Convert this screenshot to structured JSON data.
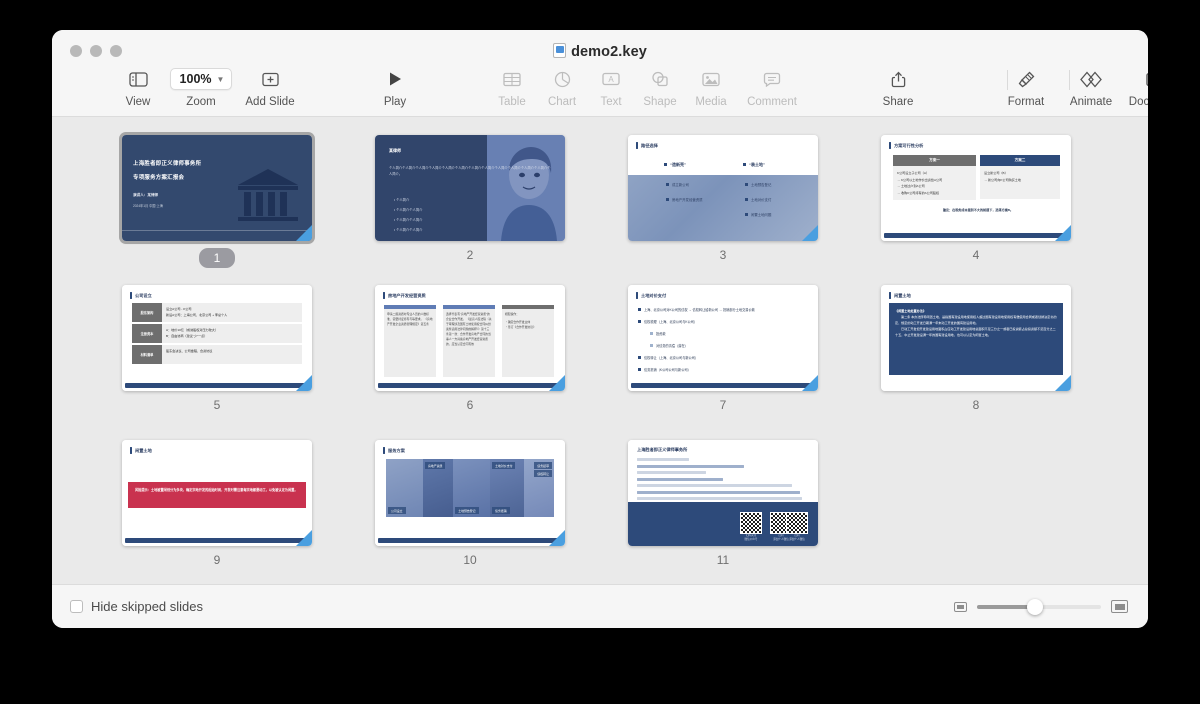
{
  "window": {
    "title": "demo2.key",
    "file_icon": "keynote-file-icon"
  },
  "toolbar": {
    "items": [
      {
        "label": "View",
        "icon": "sidebar-icon",
        "enabled": true
      },
      {
        "label": "Zoom",
        "icon": "zoom-value",
        "value": "100%",
        "enabled": true
      },
      {
        "label": "Add Slide",
        "icon": "plus-square-icon",
        "enabled": true
      },
      {
        "label": "Play",
        "icon": "play-triangle-icon",
        "enabled": true
      },
      {
        "label": "Table",
        "icon": "table-icon",
        "enabled": false
      },
      {
        "label": "Chart",
        "icon": "pie-chart-icon",
        "enabled": false
      },
      {
        "label": "Text",
        "icon": "text-box-icon",
        "enabled": false
      },
      {
        "label": "Shape",
        "icon": "shapes-icon",
        "enabled": false
      },
      {
        "label": "Media",
        "icon": "image-icon",
        "enabled": false
      },
      {
        "label": "Comment",
        "icon": "comment-bubble-icon",
        "enabled": false
      },
      {
        "label": "Share",
        "icon": "share-upload-icon",
        "enabled": true
      },
      {
        "label": "Format",
        "icon": "paintbrush-icon",
        "enabled": true
      },
      {
        "label": "Animate",
        "icon": "animate-diamond-icon",
        "enabled": true
      },
      {
        "label": "Document",
        "icon": "document-icon",
        "enabled": true
      }
    ]
  },
  "navigator": {
    "selected_slide": 1,
    "slides": [
      {
        "number": "1",
        "type": "title",
        "title_line1": "上海胜者即正义律师事务所",
        "title_line2": "专项服务方案汇报会",
        "presenter": "演讲人：某律师",
        "date": "2024年1月 中国·上海"
      },
      {
        "number": "2",
        "type": "profile",
        "title": "某律师",
        "paragraph": "个人简介个人简介个人简介个人简介个人简介个人简介个人简介个人简介个人简介个人简介个人简介个人简介个人简介。",
        "bullets": [
          "个人简介",
          "个人简介个人简介",
          "个人简介个人简介",
          "个人简介个人简介"
        ]
      },
      {
        "number": "3",
        "type": "two-column",
        "title": "路径选择",
        "left_header": "“造新壳”",
        "left_items": [
          "成立新公司",
          "房地产开发经营资质"
        ],
        "right_header": "“装土地”",
        "right_items": [
          "土地预告登记",
          "土地对价支付",
          "闲置土地问题"
        ]
      },
      {
        "number": "4",
        "type": "comparison",
        "title": "方案可行性分析",
        "plan_a_header": "方案一",
        "plan_a_lead": "K公司设立子公司（A）",
        "plan_a_items": [
          "→ K公司以土地作价出资给A公司",
          "→ 土地过户到A公司",
          "→ 收购K公司持有的A公司股权"
        ],
        "plan_b_header": "方案二",
        "plan_b_lead": "设立新公司（B）",
        "plan_b_items": [
          "→ 新公司向K公司购买土地"
        ],
        "footer": "建议：在税务成本差别不大的前提下，选择方案B。"
      },
      {
        "number": "5",
        "type": "table",
        "title": "公司设立",
        "rows": [
          {
            "key": "股东架构",
            "lines": [
              "设立A公司 - K公司",
              "新设A公司：上海公司、北京公司 + 李总个人"
            ]
          },
          {
            "key": "注册资本",
            "lines": [
              "A：地价10亿（成熟股权对压力较大）",
              "B：自由协商（建议“少”一点）"
            ]
          },
          {
            "key": "材料清单",
            "lines": [
              "股东会决议、公司章程、合资协议"
            ]
          }
        ]
      },
      {
        "number": "6",
        "type": "three-column",
        "title": "房地产开发经营资质",
        "col1": "申请二级资质时专业人员的人数标准、需要持证持有与等要求。\n\n《房地产开发企业资质管理规定》第五条",
        "col2": "选择代表有“房地产开发经营资质”的企业合作开发。\n\n《最高人民法院（关于审理涉及国有土地使用权合同纠纷案件适用法律问题的解释）》第十三条第一款：合作开发房地产合同的当事人一方具备房地产开发经营资质的，应当认定合同有效",
        "col3_title": "相配操作：",
        "col3_items": [
          "确定合作开发主体",
          "签订《合作开发协议》"
        ]
      },
      {
        "number": "7",
        "type": "bullets",
        "title": "土地对价支付",
        "items": [
          {
            "level": 1,
            "text": "上海、北京公司对K公司的债权 → 债权转让给新公司 → 抵销部分土地交易价款"
          },
          {
            "level": 1,
            "text": "债权梳理（上海、北京公司与K公司）"
          },
          {
            "level": 2,
            "text": "投资款"
          },
          {
            "level": 2,
            "text": "对债务的清偿（潜在）"
          },
          {
            "level": 1,
            "text": "债权转让（上海、北京公司与新公司）"
          },
          {
            "level": 1,
            "text": "债务抵销（K公司公司与新公司）"
          }
        ]
      },
      {
        "number": "8",
        "type": "quote",
        "title": "闲置土地",
        "quote_title": "《闲置土地处置办法》",
        "paragraph1": "第二条 本办法所称闲置土地，是指国有建设用地使用权人超过国有建设用地使用权有偿使用合同或者划拨决定书约定、规定的动工开发日期满一年未动工开发的国有建设用地。",
        "paragraph2": "已动工开发但开发建设用地面积占应动工开发建设用地总面积不足三分之一或者已投资额占总投资额不足百分之二十五，中止开发建设满一年的国有建设用地，也可以认定为闲置土地。"
      },
      {
        "number": "9",
        "type": "warning",
        "title": "闲置土地",
        "warning": "风险提示：土地被置闲划分为多块，确定宗地开发的起始时间，开发时需注意每宗地都要动工，以免被认定为闲置。"
      },
      {
        "number": "10",
        "type": "mosaic",
        "title": "服务方案",
        "tags": [
          "公司设立",
          "房地产资质",
          "土地预告登记",
          "土地对价支付",
          "债务抵销",
          "债务起草",
          "债权转让"
        ]
      },
      {
        "number": "11",
        "type": "contact",
        "title": "上海胜者即正义律师事务所",
        "qr_labels": [
          "扫码关注\n微信公众号",
          "扫码\n添加个人微信",
          "扫码\n添加个人微信"
        ]
      }
    ]
  },
  "footer": {
    "hide_skipped_label": "Hide skipped slides",
    "hide_skipped_checked": false,
    "zoom_small_icon": "small-thumbnail-icon",
    "zoom_large_icon": "large-thumbnail-icon",
    "slider_value": 42
  },
  "colors": {
    "navy": "#33496e",
    "accent_blue": "#2d4a7a",
    "corner_blue": "#4a9fe0",
    "warning_red": "#c9324f",
    "canvas_bg": "#eaeaea",
    "chrome_bg": "#f6f6f6"
  }
}
